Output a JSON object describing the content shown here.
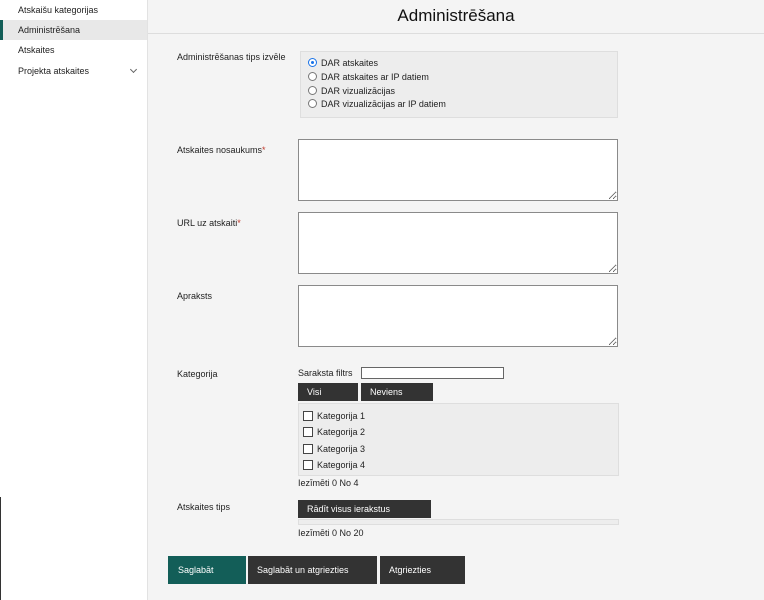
{
  "sidebar": {
    "items": [
      {
        "label": "Atskaišu kategorijas"
      },
      {
        "label": "Administrēšana"
      },
      {
        "label": "Atskaites"
      },
      {
        "label": "Projekta atskaites"
      }
    ]
  },
  "page": {
    "title": "Administrēšana"
  },
  "form": {
    "type_label": "Administrēšanas tips izvēle",
    "type_options": [
      {
        "label": "DAR atskaites",
        "selected": true
      },
      {
        "label": "DAR atskaites ar IP datiem",
        "selected": false
      },
      {
        "label": "DAR vizualizācijas",
        "selected": false
      },
      {
        "label": "DAR vizualizācijas ar IP datiem",
        "selected": false
      }
    ],
    "name_label": "Atskaites nosaukums",
    "url_label": "URL uz atskaiti",
    "required_mark": "*",
    "description_label": "Apraksts",
    "name_value": "",
    "url_value": "",
    "description_value": ""
  },
  "category": {
    "label": "Kategorija",
    "filter_label": "Saraksta filtrs",
    "filter_value": "",
    "all_button": "Visi",
    "none_button": "Neviens",
    "items": [
      {
        "label": "Kategorija 1",
        "checked": false
      },
      {
        "label": "Kategorija 2",
        "checked": false
      },
      {
        "label": "Kategorija 3",
        "checked": false
      },
      {
        "label": "Kategorija 4",
        "checked": false
      }
    ],
    "count_text": "Iezīmēti 0 No 4"
  },
  "report_type": {
    "label": "Atskaites tips",
    "show_all_button": "Rādīt visus ierakstus",
    "count_text": "Iezīmēti 0 No 20"
  },
  "actions": {
    "save": "Saglabāt",
    "save_and_back": "Saglabāt un atgriezties",
    "back": "Atgriezties"
  },
  "colors": {
    "accent": "#135e58",
    "dark_button": "#333333",
    "radio_selected": "#1a73e8",
    "required": "#c0392b"
  }
}
